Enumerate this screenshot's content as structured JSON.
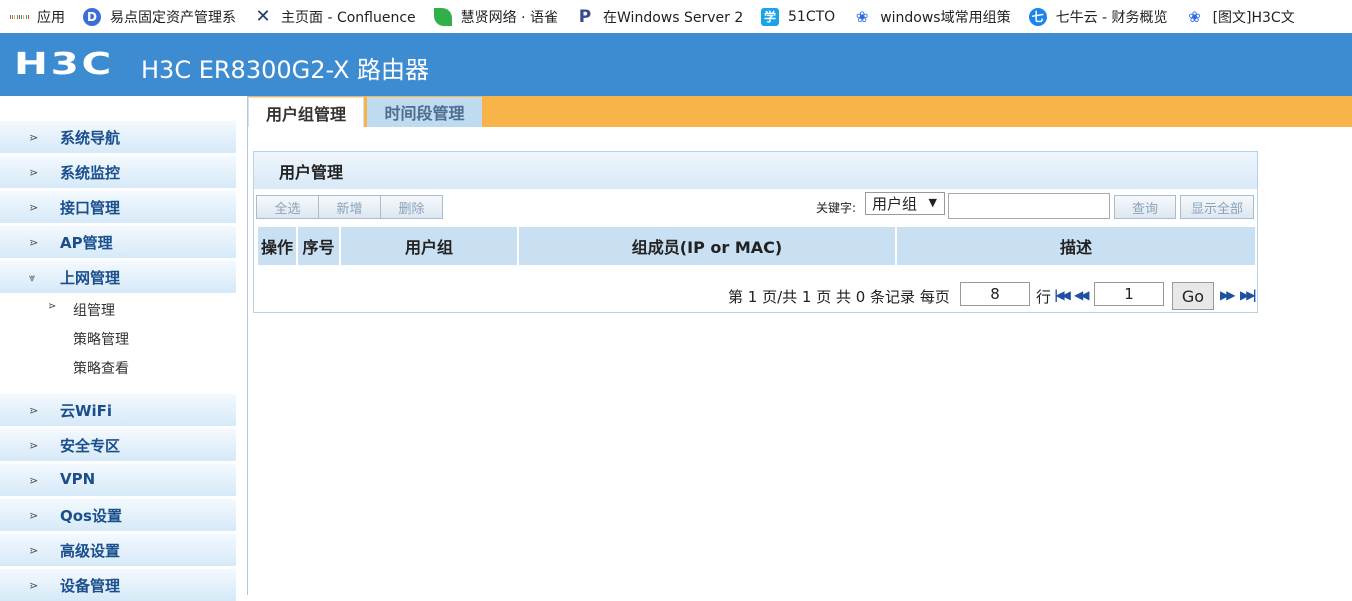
{
  "bookmarks": [
    {
      "label": "应用",
      "icon": "apps-grid-icon",
      "color": "#e94235"
    },
    {
      "label": "易点固定资产管理系",
      "icon": "yidian-icon",
      "color": "#3b6fd8"
    },
    {
      "label": "主页面 - Confluence",
      "icon": "confluence-icon",
      "color": "#1f3c6e"
    },
    {
      "label": "慧贤网络 · 语雀",
      "icon": "yuque-leaf-icon",
      "color": "#31b049"
    },
    {
      "label": "在Windows Server 2",
      "icon": "p-bookmark-icon",
      "color": "#3a4a8c"
    },
    {
      "label": "51CTO",
      "icon": "51cto-icon",
      "color": "#1aa3e8"
    },
    {
      "label": "windows域常用组策",
      "icon": "baidu-paw-icon",
      "color": "#2e6fe0"
    },
    {
      "label": "七牛云 - 财务概览",
      "icon": "qiniu-icon",
      "color": "#1c86e8"
    },
    {
      "label": "[图文]H3C文",
      "icon": "baidu-paw-icon",
      "color": "#2e6fe0"
    }
  ],
  "header": {
    "logo": "H3C",
    "title": "H3C ER8300G2-X 路由器"
  },
  "sidebar": {
    "items": [
      {
        "label": "系统导航"
      },
      {
        "label": "系统监控"
      },
      {
        "label": "接口管理"
      },
      {
        "label": "AP管理"
      },
      {
        "label": "上网管理"
      },
      {
        "label": "云WiFi"
      },
      {
        "label": "安全专区"
      },
      {
        "label": "VPN"
      },
      {
        "label": "Qos设置"
      },
      {
        "label": "高级设置"
      },
      {
        "label": "设备管理"
      }
    ],
    "subitems": [
      {
        "label": "组管理",
        "selected": true
      },
      {
        "label": "策略管理"
      },
      {
        "label": "策略查看"
      }
    ]
  },
  "tabs": [
    {
      "label": "用户组管理",
      "active": true
    },
    {
      "label": "时间段管理"
    }
  ],
  "panel": {
    "title": "用户管理",
    "buttons": {
      "select_all": "全选",
      "add": "新增",
      "delete": "删除",
      "query": "查询",
      "show_all": "显示全部"
    },
    "keyword_label": "关键字:",
    "keyword_select": "用户组",
    "keyword_value": "",
    "columns": [
      "操作",
      "序号",
      "用户组",
      "组成员(IP or MAC)",
      "描述"
    ],
    "rows": []
  },
  "pager": {
    "text1": "第 1 页/共 1 页 共 0 条记录 每页",
    "per_page": "8",
    "text2": "行",
    "page": "1",
    "go_label": "Go"
  },
  "colors": {
    "header_bg": "#3d8bd0",
    "tabbar_bg": "#f8b448",
    "nav_text": "#1a4f8c"
  }
}
